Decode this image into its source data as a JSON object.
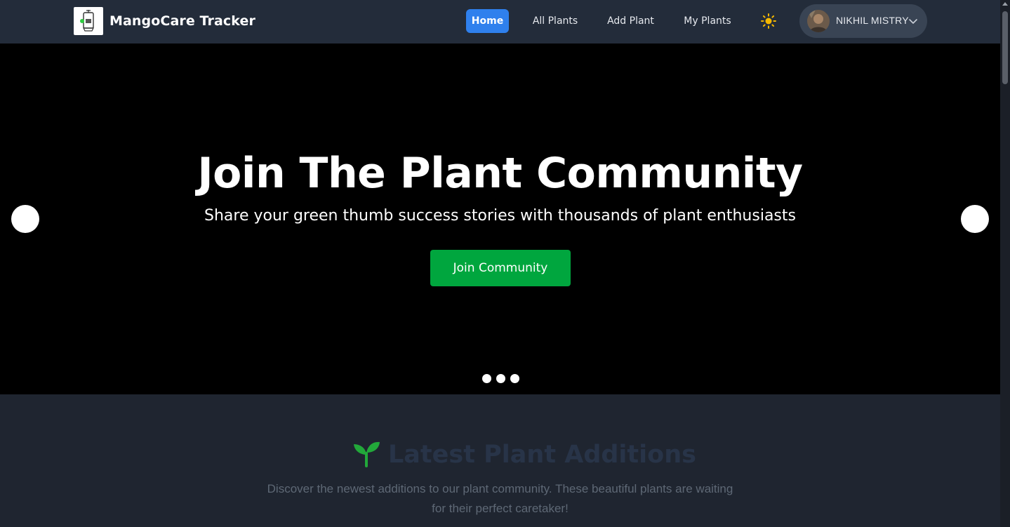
{
  "navbar": {
    "brand": "MangoCare Tracker",
    "links": [
      {
        "label": "Home",
        "active": true
      },
      {
        "label": "All Plants",
        "active": false
      },
      {
        "label": "Add Plant",
        "active": false
      },
      {
        "label": "My Plants",
        "active": false
      }
    ],
    "theme_icon": "sun-icon",
    "user": {
      "name": "NIKHIL MISTRY",
      "dropdown_icon": "chevron-down-icon"
    }
  },
  "hero": {
    "title": "Join The Plant Community",
    "subtitle": "Share your green thumb success stories with thousands of plant enthusiasts",
    "cta": "Join Community",
    "slide_count": 3
  },
  "latest": {
    "icon": "sprout-icon",
    "title": "Latest Plant Additions",
    "description": "Discover the newest additions to our plant community. These beautiful plants are waiting for their perfect caretaker!"
  },
  "colors": {
    "nav_bg": "#232c3a",
    "accent_blue": "#2f80ed",
    "cta_green": "#00a63e",
    "page_bg": "#1f2530"
  }
}
